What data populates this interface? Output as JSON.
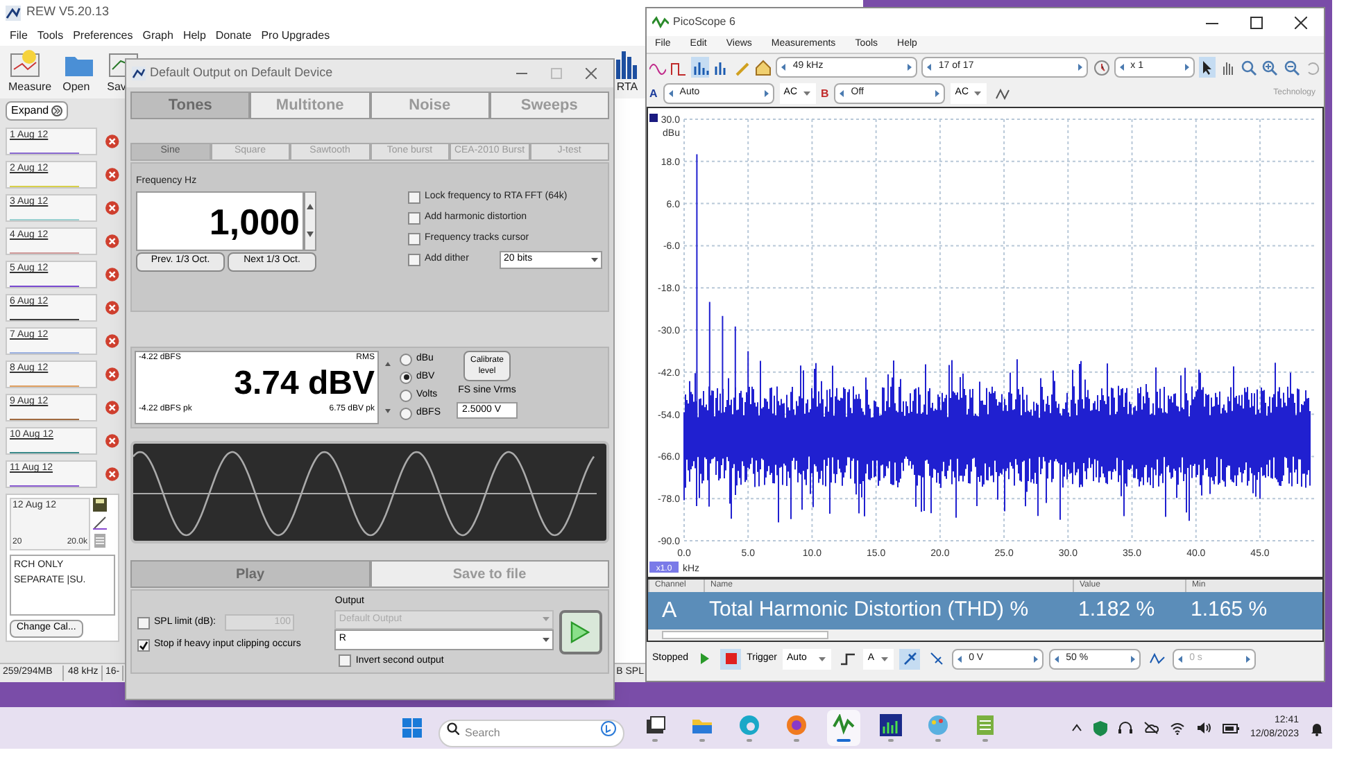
{
  "rew": {
    "title": "REW V5.20.13",
    "menu": [
      "File",
      "Tools",
      "Preferences",
      "Graph",
      "Help",
      "Donate",
      "Pro Upgrades"
    ],
    "toolbar": [
      {
        "kind": "measure",
        "label": "Measure"
      },
      {
        "kind": "open",
        "label": "Open"
      },
      {
        "kind": "save",
        "label": "Sav"
      }
    ],
    "rta": {
      "label": "RTA"
    },
    "expand": "Expand",
    "measurements": [
      {
        "label": "1 Aug 12"
      },
      {
        "label": "2 Aug 12"
      },
      {
        "label": "3 Aug 12"
      },
      {
        "label": "4 Aug 12"
      },
      {
        "label": "5 Aug 12"
      },
      {
        "label": "6 Aug 12"
      },
      {
        "label": "7 Aug 12"
      },
      {
        "label": "8 Aug 12"
      },
      {
        "label": "9 Aug 12"
      },
      {
        "label": "10 Aug 12"
      },
      {
        "label": "11 Aug 12"
      }
    ],
    "current": {
      "label": "12 Aug 12",
      "axis_min": "20",
      "axis_max": "20.0k",
      "notes": "RCH ONLY SEPARATE |SU.",
      "change_cal": "Change Cal..."
    },
    "status_bar": [
      "259/294MB",
      "48 kHz",
      "16-"
    ],
    "status_right": "B SPL"
  },
  "generator": {
    "title": "Default Output on Default Device",
    "signal_tabs": [
      {
        "label": "Tones",
        "selected": true
      },
      {
        "label": "Multitone",
        "selected": false
      },
      {
        "label": "Noise",
        "selected": false
      },
      {
        "label": "Sweeps",
        "selected": false
      }
    ],
    "waveform_tabs": [
      {
        "label": "Sine",
        "selected": true
      },
      {
        "label": "Square",
        "selected": false
      },
      {
        "label": "Sawtooth",
        "selected": false
      },
      {
        "label": "Tone burst",
        "selected": false
      },
      {
        "label": "CEA-2010 Burst",
        "selected": false
      },
      {
        "label": "J-test",
        "selected": false
      }
    ],
    "frequency_label": "Frequency Hz",
    "frequency": "1,000",
    "step_buttons": [
      "Prev. 1/3 Oct.",
      "Next 1/3 Oct."
    ],
    "options": [
      {
        "label": "Lock frequency to RTA FFT (64k)",
        "checked": false
      },
      {
        "label": "Add harmonic distortion",
        "checked": false
      },
      {
        "label": "Frequency tracks cursor",
        "checked": false
      },
      {
        "label": "Add dither",
        "checked": false
      }
    ],
    "dither_bits": "20 bits",
    "level": {
      "top_left": "-4.22 dBFS",
      "top_right": "RMS",
      "value": "3.74 dBV",
      "bottom_left": "-4.22 dBFS pk",
      "bottom_right": "6.75 dBV pk"
    },
    "units": [
      {
        "label": "dBu",
        "selected": false
      },
      {
        "label": "dBV",
        "selected": true
      },
      {
        "label": "Volts",
        "selected": false
      },
      {
        "label": "dBFS",
        "selected": false
      }
    ],
    "calibrate": "Calibrate level",
    "fs_label": "FS sine Vrms",
    "fs_value": "2.5000 V",
    "play": "Play",
    "save": "Save to file",
    "spl_limit": {
      "label": "SPL limit (dB):",
      "checked": false,
      "value": "100"
    },
    "stop_clipping": {
      "label": "Stop if heavy input clipping occurs",
      "checked": true
    },
    "output_label": "Output",
    "output_device": "Default Output",
    "output_channel": "R",
    "invert": {
      "label": "Invert second output",
      "checked": false
    }
  },
  "picoscope": {
    "title": "PicoScope 6",
    "menu": [
      "File",
      "Edit",
      "Views",
      "Measurements",
      "Tools",
      "Help"
    ],
    "timebase": "49 kHz",
    "capture": "17 of 17",
    "zoom": "x 1",
    "channel_a": {
      "label": "A",
      "range": "Auto",
      "coupling": "AC"
    },
    "channel_b": {
      "label": "B",
      "range": "Off",
      "coupling": "AC"
    },
    "brand": "Technology",
    "y_unit": "dBu",
    "y_ticks": [
      "30.0",
      "18.0",
      "6.0",
      "-6.0",
      "-18.0",
      "-30.0",
      "-42.0",
      "-54.0",
      "-66.0",
      "-78.0",
      "-90.0"
    ],
    "x_ticks": [
      "0.0",
      "5.0",
      "10.0",
      "15.0",
      "20.0",
      "25.0",
      "30.0",
      "35.0",
      "40.0",
      "45.0"
    ],
    "x_scale": "x1.0",
    "x_unit": "kHz",
    "columns": [
      "Channel",
      "Name",
      "Value",
      "Min"
    ],
    "rows": [
      {
        "channel": "A",
        "name": "Total Harmonic Distortion (THD) %",
        "value": "1.182 %",
        "min": "1.165 %",
        "selected": true
      }
    ],
    "status": "Stopped",
    "trigger_label": "Trigger",
    "trigger_mode": "Auto",
    "trigger_channel": "A",
    "trigger_level": "0 V",
    "pretrigger": "50 %",
    "delay": "0 s"
  },
  "taskbar": {
    "search_placeholder": "Search",
    "apps": [
      {
        "kind": "task-view",
        "selected": false
      },
      {
        "kind": "files",
        "selected": false
      },
      {
        "kind": "edge",
        "selected": false
      },
      {
        "kind": "firefox",
        "selected": false
      },
      {
        "kind": "scope",
        "selected": true
      },
      {
        "kind": "rew",
        "selected": false
      },
      {
        "kind": "paint",
        "selected": false
      },
      {
        "kind": "notes",
        "selected": false
      }
    ],
    "time": "12:41",
    "date": "12/08/2023"
  }
}
